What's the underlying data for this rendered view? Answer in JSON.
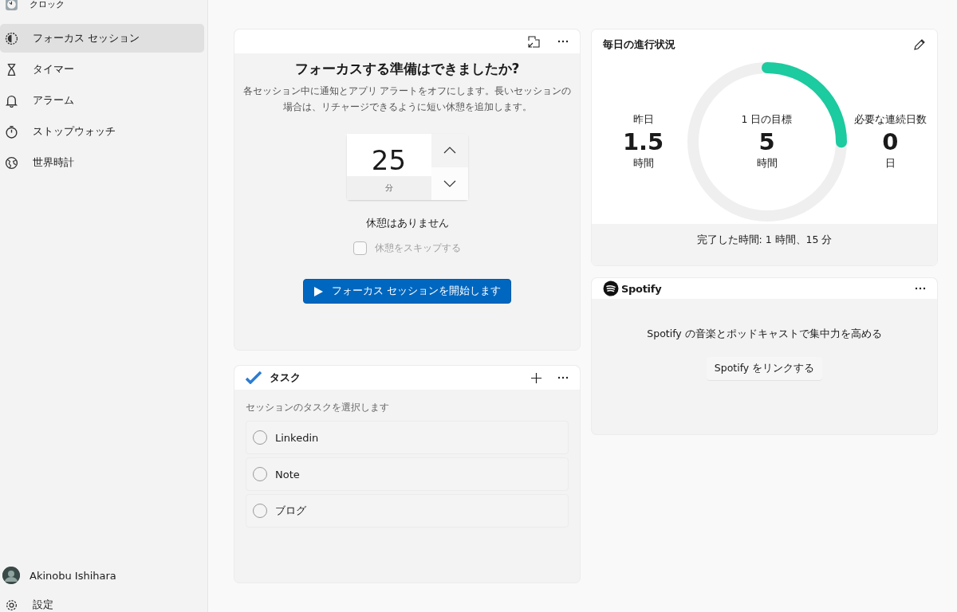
{
  "sidebar": {
    "app_title": "クロック",
    "items": [
      {
        "label": "フォーカス セッション",
        "kind": "focus",
        "selected": true
      },
      {
        "label": "タイマー",
        "kind": "timer",
        "selected": false
      },
      {
        "label": "アラーム",
        "kind": "alarm",
        "selected": false
      },
      {
        "label": "ストップウォッチ",
        "kind": "stopwatch",
        "selected": false
      },
      {
        "label": "世界時計",
        "kind": "world",
        "selected": false
      }
    ],
    "user": {
      "name": "Akinobu Ishihara"
    },
    "settings": {
      "label": "設定"
    }
  },
  "focus": {
    "title": "フォーカスする準備はできましたか?",
    "description": "各セッション中に通知とアプリ アラートをオフにします。長いセッションの場合は、リチャージできるように短い休憩を追加します。",
    "timer": {
      "value": "25",
      "unit": "分"
    },
    "break_text": "休憩はありません",
    "skip_break": {
      "label": "休憩をスキップする",
      "checked": false,
      "disabled": true
    },
    "start_button": {
      "label": "フォーカス セッションを開始します"
    }
  },
  "tasks": {
    "title": "タスク",
    "hint": "セッションのタスクを選択します",
    "items": [
      {
        "label": "Linkedin",
        "checked": false
      },
      {
        "label": "Note",
        "checked": false
      },
      {
        "label": "ブログ",
        "checked": false
      }
    ]
  },
  "progress": {
    "title": "毎日の進行状況",
    "yesterday": {
      "label": "昨日",
      "value": "1.5",
      "unit": "時間"
    },
    "goal": {
      "label": "1 日の目標",
      "value": "5",
      "unit": "時間",
      "level": 0.25
    },
    "streak": {
      "label": "必要な連続日数",
      "value": "0",
      "unit": "日"
    },
    "completed": "完了した時間: 1 時間、15 分"
  },
  "spotify": {
    "brand": "Spotify",
    "message": "Spotify の音楽とポッドキャストで集中力を高める",
    "link_button": "Spotify をリンクする"
  }
}
